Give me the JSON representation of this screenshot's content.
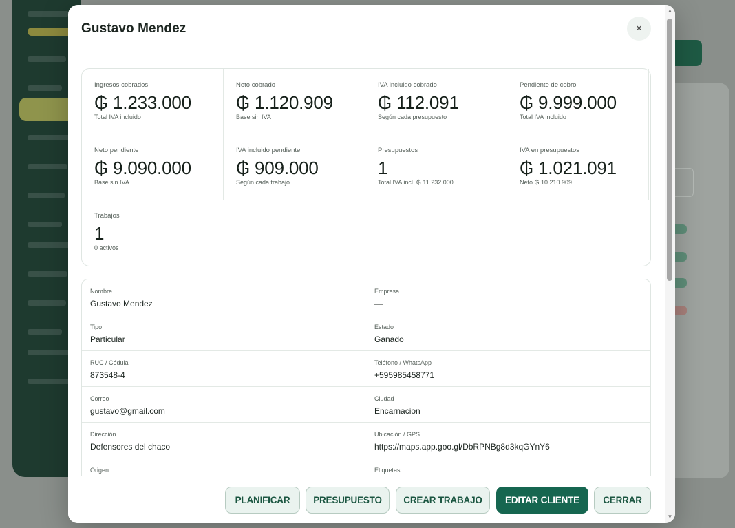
{
  "modal": {
    "title": "Gustavo Mendez",
    "close_label": "×"
  },
  "stats": [
    {
      "label": "Ingresos cobrados",
      "value": "₲ 1.233.000",
      "sub": "Total IVA incluido"
    },
    {
      "label": "Neto cobrado",
      "value": "₲ 1.120.909",
      "sub": "Base sin IVA"
    },
    {
      "label": "IVA incluido cobrado",
      "value": "₲ 112.091",
      "sub": "Según cada presupuesto"
    },
    {
      "label": "Pendiente de cobro",
      "value": "₲ 9.999.000",
      "sub": "Total IVA incluido"
    },
    {
      "label": "Neto pendiente",
      "value": "₲ 9.090.000",
      "sub": "Base sin IVA"
    },
    {
      "label": "IVA incluido pendiente",
      "value": "₲ 909.000",
      "sub": "Según cada trabajo"
    },
    {
      "label": "Presupuestos",
      "value": "1",
      "sub": "Total IVA incl. ₲ 11.232.000"
    },
    {
      "label": "IVA en presupuestos",
      "value": "₲ 1.021.091",
      "sub": "Neto ₲ 10.210.909"
    },
    {
      "label": "Trabajos",
      "value": "1",
      "sub": "0 activos"
    }
  ],
  "details": [
    {
      "left": {
        "label": "Nombre",
        "value": "Gustavo Mendez"
      },
      "right": {
        "label": "Empresa",
        "value": "—"
      }
    },
    {
      "left": {
        "label": "Tipo",
        "value": "Particular"
      },
      "right": {
        "label": "Estado",
        "value": "Ganado"
      }
    },
    {
      "left": {
        "label": "RUC / Cédula",
        "value": "873548-4"
      },
      "right": {
        "label": "Teléfono / WhatsApp",
        "value": "+595985458771"
      }
    },
    {
      "left": {
        "label": "Correo",
        "value": "gustavo@gmail.com"
      },
      "right": {
        "label": "Ciudad",
        "value": "Encarnacion"
      }
    },
    {
      "left": {
        "label": "Dirección",
        "value": "Defensores del chaco"
      },
      "right": {
        "label": "Ubicación / GPS",
        "value": "https://maps.app.goo.gl/DbRPNBg8d3kqGYnY6"
      }
    },
    {
      "left": {
        "label": "Origen",
        "value": ""
      },
      "right": {
        "label": "Etiquetas",
        "value": ""
      }
    }
  ],
  "footer": {
    "planificar": "PLANIFICAR",
    "presupuesto": "PRESUPUESTO",
    "crear_trabajo": "CREAR TRABAJO",
    "editar_cliente": "EDITAR CLIENTE",
    "cerrar": "CERRAR"
  },
  "colors": {
    "primary": "#166650",
    "secondary_bg": "#eaf3ef",
    "secondary_text": "#1a5540",
    "sidebar_bg": "#1e3a2f"
  },
  "icons": {
    "close": "close-icon",
    "scroll_up": "scroll-up-arrow-icon",
    "scroll_down": "scroll-down-arrow-icon"
  }
}
